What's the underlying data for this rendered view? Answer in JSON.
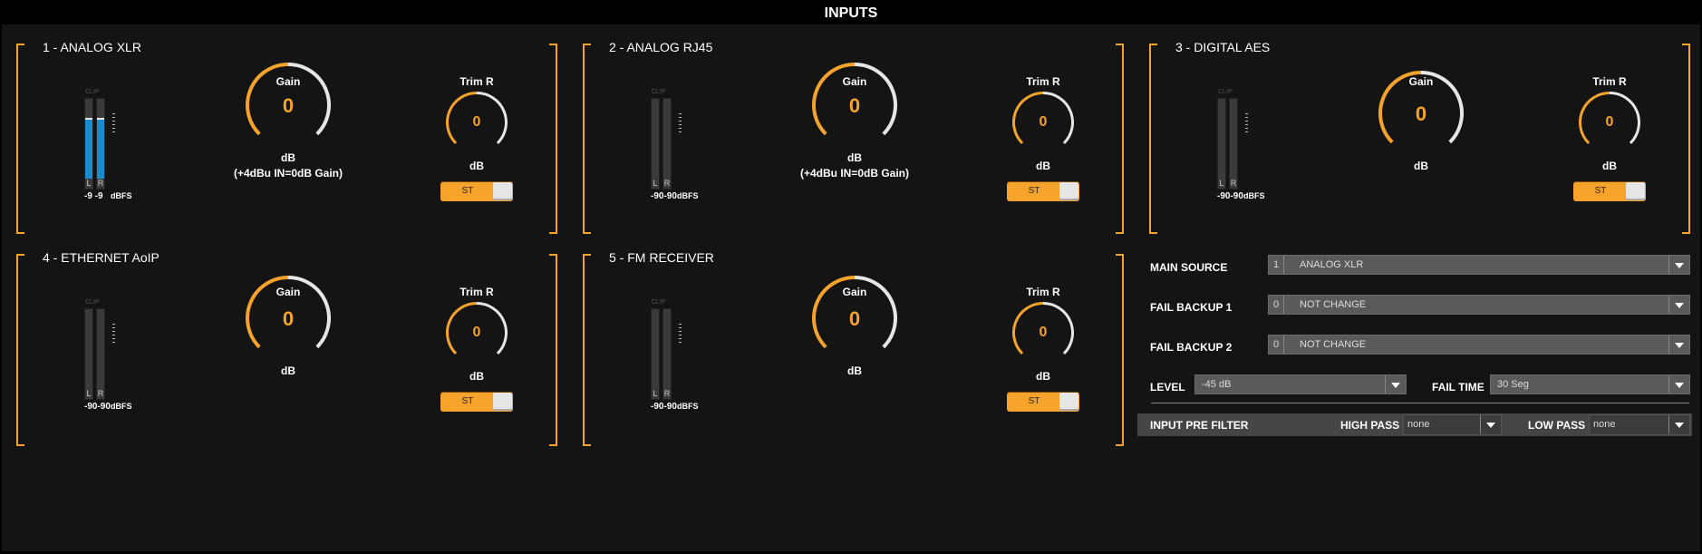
{
  "title": "INPUTS",
  "panels": [
    {
      "title": "1 - ANALOG XLR",
      "meter": {
        "clip": "CLIP",
        "l": "L",
        "r": "R",
        "values": "-9 -9",
        "unit": "dBFS",
        "level_l": 0.72,
        "level_r": 0.72
      },
      "gain": {
        "label": "Gain",
        "value": "0",
        "unit": "dB",
        "note": "(+4dBu IN=0dB Gain)"
      },
      "trim": {
        "label": "Trim R",
        "value": "0",
        "unit": "dB",
        "switch": "ST"
      }
    },
    {
      "title": "2 - ANALOG RJ45",
      "meter": {
        "clip": "CLIP",
        "l": "L",
        "r": "R",
        "values": "-90-90",
        "unit": "dBFS",
        "level_l": 0,
        "level_r": 0
      },
      "gain": {
        "label": "Gain",
        "value": "0",
        "unit": "dB",
        "note": "(+4dBu IN=0dB Gain)"
      },
      "trim": {
        "label": "Trim R",
        "value": "0",
        "unit": "dB",
        "switch": "ST"
      }
    },
    {
      "title": "3 - DIGITAL AES",
      "meter": {
        "clip": "CLIP",
        "l": "L",
        "r": "R",
        "values": "-90-90",
        "unit": "dBFS",
        "level_l": 0,
        "level_r": 0
      },
      "gain": {
        "label": "Gain",
        "value": "0",
        "unit": "dB"
      },
      "trim": {
        "label": "Trim R",
        "value": "0",
        "unit": "dB",
        "switch": "ST"
      }
    },
    {
      "title": "4 - ETHERNET AoIP",
      "meter": {
        "clip": "CLIP",
        "l": "L",
        "r": "R",
        "values": "-90-90",
        "unit": "dBFS",
        "level_l": 0,
        "level_r": 0
      },
      "gain": {
        "label": "Gain",
        "value": "0",
        "unit": "dB"
      },
      "trim": {
        "label": "Trim R",
        "value": "0",
        "unit": "dB",
        "switch": "ST"
      }
    },
    {
      "title": "5 - FM RECEIVER",
      "meter": {
        "clip": "CLIP",
        "l": "L",
        "r": "R",
        "values": "-90-90",
        "unit": "dBFS",
        "level_l": 0,
        "level_r": 0
      },
      "gain": {
        "label": "Gain",
        "value": "0",
        "unit": "dB"
      },
      "trim": {
        "label": "Trim R",
        "value": "0",
        "unit": "dB",
        "switch": "ST"
      }
    }
  ],
  "settings": {
    "main_source": {
      "label": "MAIN SOURCE",
      "num": "1",
      "value": "ANALOG XLR"
    },
    "fail_backup_1": {
      "label": "FAIL BACKUP 1",
      "num": "0",
      "value": "NOT CHANGE"
    },
    "fail_backup_2": {
      "label": "FAIL BACKUP 2",
      "num": "0",
      "value": "NOT CHANGE"
    },
    "level": {
      "label": "LEVEL",
      "value": "-45 dB"
    },
    "fail_time": {
      "label": "FAIL TIME",
      "value": "30 Seg"
    },
    "prefilter": {
      "label": "INPUT PRE FILTER",
      "high_pass_label": "HIGH PASS",
      "high_pass": "none",
      "low_pass_label": "LOW PASS",
      "low_pass": "none"
    }
  },
  "colors": {
    "accent": "#f5a32a",
    "meter_fill": "#1a8ccc",
    "background": "#141414"
  }
}
